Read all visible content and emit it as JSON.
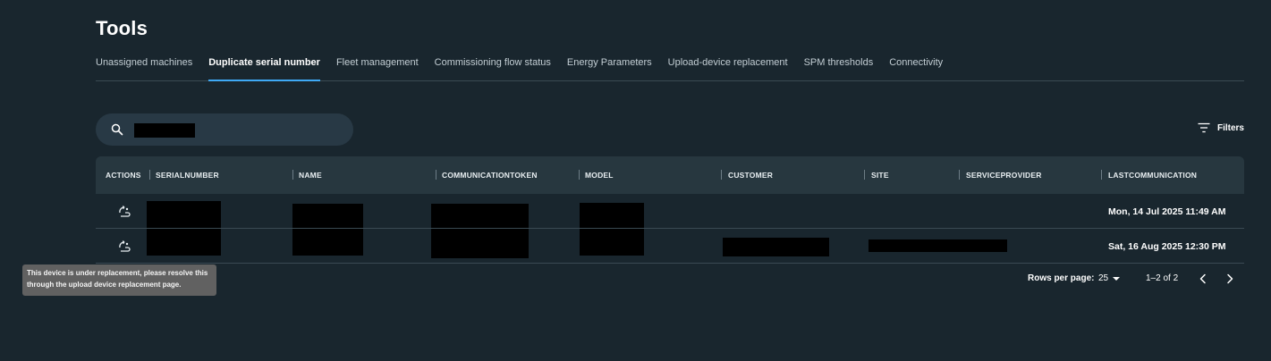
{
  "page": {
    "title": "Tools"
  },
  "tabs": [
    {
      "label": "Unassigned machines",
      "active": false
    },
    {
      "label": "Duplicate serial number",
      "active": true
    },
    {
      "label": "Fleet management",
      "active": false
    },
    {
      "label": "Commissioning flow status",
      "active": false
    },
    {
      "label": "Energy Parameters",
      "active": false
    },
    {
      "label": "Upload-device replacement",
      "active": false
    },
    {
      "label": "SPM thresholds",
      "active": false
    },
    {
      "label": "Connectivity",
      "active": false
    }
  ],
  "search": {
    "icon": "search-icon",
    "value": ""
  },
  "filters": {
    "label": "Filters",
    "icon": "filter-lines-icon"
  },
  "table": {
    "columns": [
      "ACTIONS",
      "SERIALNUMBER",
      "NAME",
      "COMMUNICATIONTOKEN",
      "MODEL",
      "CUSTOMER",
      "SITE",
      "SERVICEPROVIDER",
      "LASTCOMMUNICATION"
    ],
    "rows": [
      {
        "action_icon": "device-replacement-icon",
        "lastcommunication": "Mon, 14 Jul 2025 11:49 AM"
      },
      {
        "action_icon": "device-replacement-icon",
        "lastcommunication": "Sat, 16 Aug 2025 12:30 PM"
      }
    ]
  },
  "tooltip": {
    "text": "This device is under replacement, please resolve this through the upload device replacement page."
  },
  "pagination": {
    "rows_per_page_label": "Rows per page:",
    "rows_per_page_value": "25",
    "range": "1–2 of 2"
  },
  "colors": {
    "background": "#19262e",
    "accent": "#3fa9f5",
    "header": "#27373f",
    "search": "#283945"
  }
}
